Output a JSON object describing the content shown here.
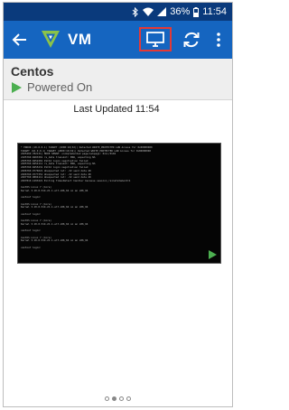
{
  "status_bar": {
    "battery": "36%",
    "time": "11:54",
    "icons": [
      "bluetooth-icon",
      "wifi-icon",
      "signal-icon",
      "battery-icon"
    ]
  },
  "app_bar": {
    "title": "VM",
    "icons": [
      "back-arrow-icon",
      "app-logo-icon",
      "monitor-icon",
      "refresh-icon",
      "more-vert-icon"
    ],
    "accent_color": "#1565c0",
    "highlight_color": "#e53935"
  },
  "vm": {
    "name": "Centos",
    "power_state": "Powered On",
    "power_color": "#4caf50"
  },
  "last_updated": {
    "label": "Last Updated",
    "time": "11:54"
  },
  "console": {
    "lines": [
      "* ERROR (10.0.0.1) TARGET (2000:10(32)) Detected WRITE_PROTECTED LUN Access for 0x00000000",
      "TARGET (10.0.0.1) TARGET (2000:10(32)) Detected WRITE_PROTECTED LUN Access for 0x00000000",
      "2205260.782131] MODE SENSE: unimplemented page/subpage: 0x1c/0x02",
      "2105760.8203301 rs_data transmit: ERR, expecting NS",
      "2305760.8452201 ISCSI login negotiation failed",
      "2405760.8454111 rs_data transmit: ERR, expecting NS",
      "2405760.8455231 ISCSI login negotiation failed",
      "2406760.9776021 Unexpected ret: -32 send data 48",
      "2406760.9777351 Unexpected ret: -32 send data 48",
      "2407760.9804111 Unexpected ret: -32 send data 48",
      "2407810.1293221 Exiting TimeoDetect handler because session_reinstatement=1",
      "",
      "CentOS Linux 7 (Core)",
      "Kernel 3.10.0-514.21.1.el7.x86_64 on an x86_64",
      "",
      "centos7 login:",
      "",
      "CentOS Linux 7 (Core)",
      "Kernel 3.10.0-514.21.1.el7.x86_64 on an x86_64",
      "",
      "centos7 login:",
      "",
      "CentOS Linux 7 (Core)",
      "Kernel 3.10.0-514.21.1.el7.x86_64 on an x86_64",
      "",
      "centos7 login:",
      "",
      "CentOS Linux 7 (Core)",
      "Kernel 3.10.0-514.21.1.el7.x86_64 on an x86_64",
      "",
      "centos7 login:"
    ]
  },
  "pager": {
    "count": 4,
    "active_index": 1
  }
}
